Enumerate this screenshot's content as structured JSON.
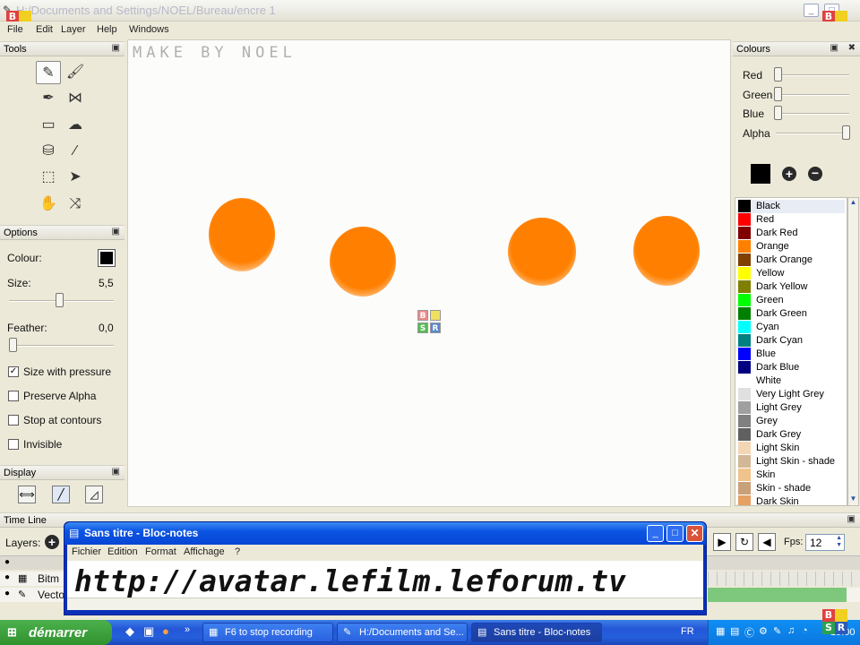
{
  "window": {
    "title": "H:/Documents and Settings/NOEL/Bureau/encre 1"
  },
  "menu": [
    "File",
    "Edit",
    "Layer",
    "Help",
    "Windows"
  ],
  "watermark": {
    "b": "B",
    "y": "",
    "s": "S",
    "r": "R"
  },
  "tools": {
    "title": "Tools"
  },
  "options": {
    "title": "Options",
    "colour_label": "Colour:",
    "size_label": "Size:",
    "size_value": "5,5",
    "feather_label": "Feather:",
    "feather_value": "0,0",
    "size_with_pressure": "Size with pressure",
    "preserve_alpha": "Preserve Alpha",
    "stop_at_contours": "Stop at contours",
    "invisible": "Invisible"
  },
  "display": {
    "title": "Display"
  },
  "canvas": {
    "handwritten": "MAKE BY NOEL"
  },
  "colours": {
    "title": "Colours",
    "red": "Red",
    "green": "Green",
    "blue": "Blue",
    "alpha": "Alpha",
    "values": {
      "red": 0,
      "green": 0,
      "blue": 0,
      "alpha": 1
    },
    "current": "#000000",
    "swatches": [
      {
        "name": "Black",
        "color": "#000000"
      },
      {
        "name": "Red",
        "color": "#ff0000"
      },
      {
        "name": "Dark Red",
        "color": "#800000"
      },
      {
        "name": "Orange",
        "color": "#ff8000"
      },
      {
        "name": "Dark Orange",
        "color": "#804000"
      },
      {
        "name": "Yellow",
        "color": "#ffff00"
      },
      {
        "name": "Dark Yellow",
        "color": "#808000"
      },
      {
        "name": "Green",
        "color": "#00ff00"
      },
      {
        "name": "Dark Green",
        "color": "#008000"
      },
      {
        "name": "Cyan",
        "color": "#00ffff"
      },
      {
        "name": "Dark Cyan",
        "color": "#008080"
      },
      {
        "name": "Blue",
        "color": "#0000ff"
      },
      {
        "name": "Dark Blue",
        "color": "#000080"
      },
      {
        "name": "White",
        "color": "#ffffff"
      },
      {
        "name": "Very Light Grey",
        "color": "#e0e0e0"
      },
      {
        "name": "Light Grey",
        "color": "#a0a0a0"
      },
      {
        "name": "Grey",
        "color": "#808080"
      },
      {
        "name": "Dark Grey",
        "color": "#606060"
      },
      {
        "name": "Light Skin",
        "color": "#f5d6b4"
      },
      {
        "name": "Light Skin - shade",
        "color": "#d2b896"
      },
      {
        "name": "Skin",
        "color": "#f0c38c"
      },
      {
        "name": "Skin - shade",
        "color": "#c8a07a"
      },
      {
        "name": "Dark Skin",
        "color": "#e6a064"
      }
    ]
  },
  "timeline": {
    "title": "Time Line",
    "layers_label": "Layers:",
    "layer1": "Bitm",
    "layer2": "Vecto",
    "fps_label": "Fps:",
    "fps_value": "12"
  },
  "notepad": {
    "title": "Sans titre - Bloc-notes",
    "menu": [
      "Fichier",
      "Edition",
      "Format",
      "Affichage",
      "?"
    ],
    "content": "http://avatar.lefilm.leforum.tv"
  },
  "taskbar": {
    "start": "démarrer",
    "tasks": [
      "F6 to stop recording",
      "H:/Documents and Se...",
      "Sans titre - Bloc-notes"
    ],
    "lang": "FR",
    "clock": "19:00"
  }
}
